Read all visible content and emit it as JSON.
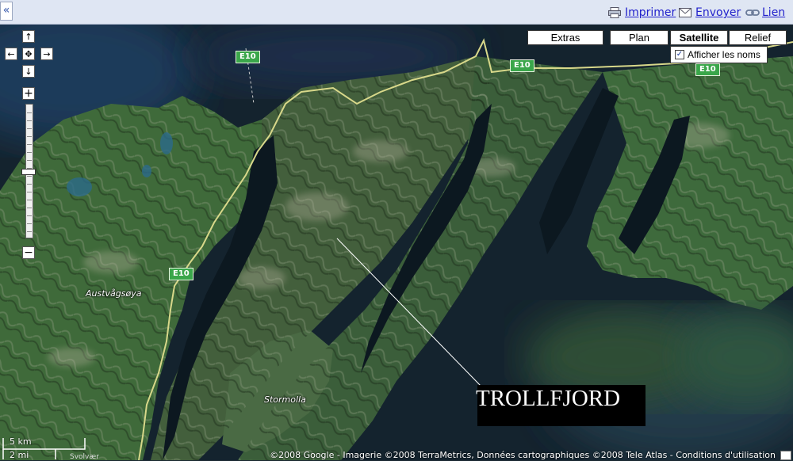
{
  "header": {
    "collapse_glyph": "«",
    "links": [
      {
        "label": "Imprimer",
        "icon": "printer-icon"
      },
      {
        "label": "Envoyer",
        "icon": "envelope-icon"
      },
      {
        "label": "Lien",
        "icon": "link-icon"
      }
    ]
  },
  "map_controls": {
    "pan": {
      "up": "↑",
      "down": "↓",
      "left": "←",
      "right": "→",
      "center": "✥"
    },
    "zoom_in": "+",
    "zoom_out": "−",
    "map_types": [
      {
        "label": "Extras",
        "active": false
      },
      {
        "label": "Plan",
        "active": false
      },
      {
        "label": "Satellite",
        "active": true
      },
      {
        "label": "Relief",
        "active": false
      }
    ],
    "show_names": {
      "label": "Afficher les noms",
      "checked": true,
      "check_glyph": "✓"
    }
  },
  "map": {
    "road_label": "E10",
    "places": [
      "Austvågsøya",
      "Stormolla"
    ],
    "callout": "TROLLFJORD",
    "scale": {
      "km": "5 km",
      "mi": "2 mi"
    },
    "partial_label": "Svolvær",
    "copyright": "©2008 Google - Imagerie ©2008 TerraMetrics, Données cartographiques ©2008 Tele Atlas - Conditions d'utilisation"
  },
  "colors": {
    "link": "#2222cc",
    "road": "#d8d88a",
    "shield": "#3aa64a",
    "water": "#0f1e28",
    "land": "#3d6b3a"
  }
}
